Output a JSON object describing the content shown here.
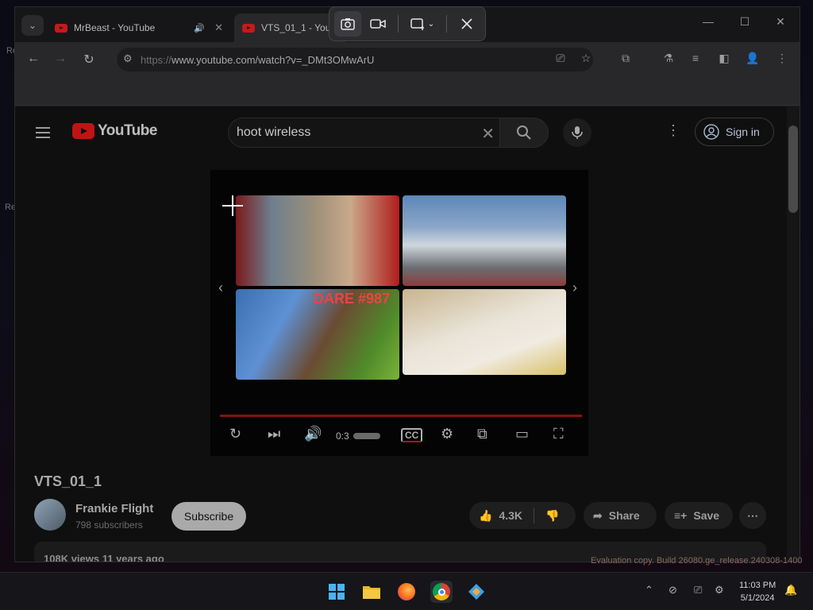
{
  "tabs": [
    {
      "title": "MrBeast - YouTube"
    },
    {
      "title": "VTS_01_1 - YouT"
    }
  ],
  "address_bar": {
    "url_prefix": "https://",
    "url": "www.youtube.com/watch?v=_DMt3OMwArU"
  },
  "youtube": {
    "logo_text": "YouTube",
    "search_query": "hoot wireless",
    "sign_in_label": "Sign in"
  },
  "player": {
    "time": "0:3",
    "thumbnail_title": "DARE #987"
  },
  "video": {
    "title": "VTS_01_1",
    "channel": "Frankie Flight",
    "subscribers": "798 subscribers",
    "subscribe_label": "Subscribe",
    "likes": "4.3K",
    "share_label": "Share",
    "save_label": "Save",
    "views_line": "108K views  11 years ago"
  },
  "overlay": {
    "evaluation_text": "Evaluation copy. Build 26080.ge_release.240308-1400"
  },
  "taskbar": {
    "time": "11:03 PM",
    "date": "5/1/2024"
  },
  "colors": {
    "youtube_red": "#c21313",
    "progress_red": "#8a1111",
    "dare_red": "#e84545"
  }
}
